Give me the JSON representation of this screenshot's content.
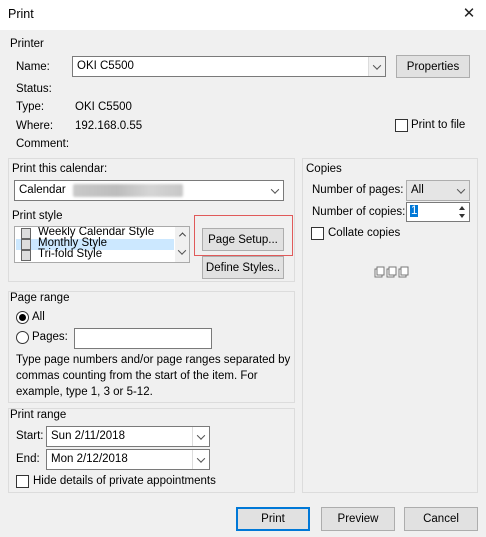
{
  "window": {
    "title": "Print"
  },
  "printer": {
    "section_label": "Printer",
    "name_label": "Name:",
    "name_value": "OKI C5500",
    "properties_label": "Properties",
    "status_label": "Status:",
    "status_value": "",
    "type_label": "Type:",
    "type_value": "OKI C5500",
    "where_label": "Where:",
    "where_value": "192.168.0.55",
    "comment_label": "Comment:",
    "print_to_file_label": "Print to file"
  },
  "calendar": {
    "section_label": "Print this calendar:",
    "value": "Calendar"
  },
  "print_style": {
    "section_label": "Print style",
    "items": [
      {
        "label": "Weekly Calendar Style",
        "selected": false
      },
      {
        "label": "Monthly Style",
        "selected": true
      },
      {
        "label": "Tri-fold Style",
        "selected": false
      }
    ],
    "page_setup_label": "Page Setup...",
    "define_styles_label": "Define Styles.."
  },
  "copies": {
    "section_label": "Copies",
    "num_pages_label": "Number of pages:",
    "num_pages_value": "All",
    "num_copies_label": "Number of copies:",
    "num_copies_value": "1",
    "collate_label": "Collate copies",
    "collate_icon": "collate-pages-icon"
  },
  "page_range": {
    "section_label": "Page range",
    "all_label": "All",
    "pages_label": "Pages:",
    "help_text_line1": "Type page numbers and/or page ranges separated by",
    "help_text_line2": "commas counting from the start of the item.  For",
    "help_text_line3": "example, type 1, 3 or 5-12."
  },
  "print_range": {
    "section_label": "Print range",
    "start_label": "Start:",
    "start_value": "Sun 2/11/2018",
    "end_label": "End:",
    "end_value": "Mon 2/12/2018",
    "hide_private_label": "Hide details of private appointments"
  },
  "footer": {
    "print_label": "Print",
    "preview_label": "Preview",
    "cancel_label": "Cancel"
  },
  "colors": {
    "accent": "#0078d7",
    "selection": "#cce8ff",
    "highlight_box": "#e05a5a"
  }
}
